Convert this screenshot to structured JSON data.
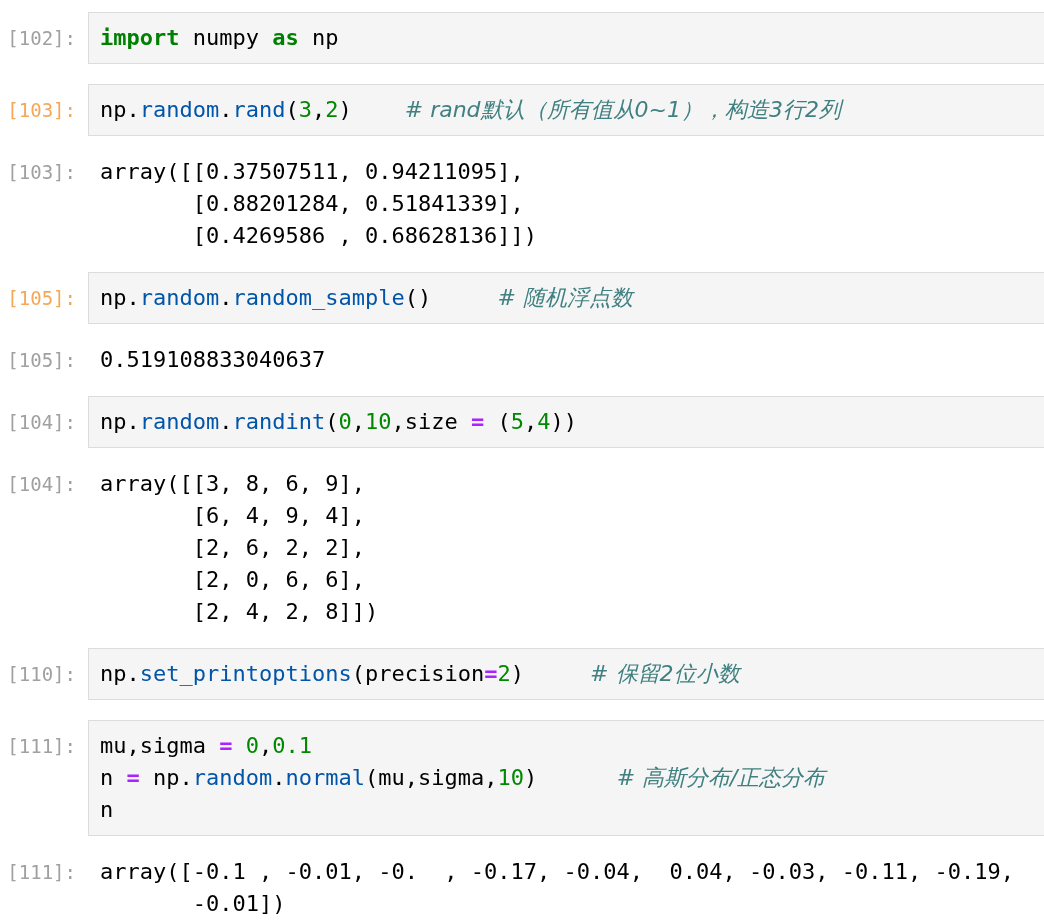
{
  "cells": [
    {
      "in_prompt": "[102]:",
      "highlighted": false,
      "input": [
        [
          {
            "text": "import",
            "kind": "keyword"
          },
          {
            "text": " numpy ",
            "kind": "plain"
          },
          {
            "text": "as",
            "kind": "keyword"
          },
          {
            "text": " np",
            "kind": "plain"
          }
        ]
      ]
    },
    {
      "in_prompt": "[103]:",
      "highlighted": true,
      "input": [
        [
          {
            "text": "np.",
            "kind": "plain"
          },
          {
            "text": "random",
            "kind": "attr"
          },
          {
            "text": ".",
            "kind": "plain"
          },
          {
            "text": "rand",
            "kind": "attr"
          },
          {
            "text": "(",
            "kind": "plain"
          },
          {
            "text": "3",
            "kind": "number"
          },
          {
            "text": ",",
            "kind": "plain"
          },
          {
            "text": "2",
            "kind": "number"
          },
          {
            "text": ")    ",
            "kind": "plain"
          },
          {
            "text": "# rand默认（所有值从0~1），构造3行2列",
            "kind": "comment"
          }
        ]
      ],
      "out_prompt": "[103]:",
      "output": [
        "array([[0.37507511, 0.94211095],",
        "       [0.88201284, 0.51841339],",
        "       [0.4269586 , 0.68628136]])"
      ]
    },
    {
      "in_prompt": "[105]:",
      "highlighted": true,
      "input": [
        [
          {
            "text": "np.",
            "kind": "plain"
          },
          {
            "text": "random",
            "kind": "attr"
          },
          {
            "text": ".",
            "kind": "plain"
          },
          {
            "text": "random_sample",
            "kind": "attr"
          },
          {
            "text": "()     ",
            "kind": "plain"
          },
          {
            "text": "# 随机浮点数",
            "kind": "comment"
          }
        ]
      ],
      "out_prompt": "[105]:",
      "output": [
        "0.519108833040637"
      ]
    },
    {
      "in_prompt": "[104]:",
      "highlighted": false,
      "input": [
        [
          {
            "text": "np.",
            "kind": "plain"
          },
          {
            "text": "random",
            "kind": "attr"
          },
          {
            "text": ".",
            "kind": "plain"
          },
          {
            "text": "randint",
            "kind": "attr"
          },
          {
            "text": "(",
            "kind": "plain"
          },
          {
            "text": "0",
            "kind": "number"
          },
          {
            "text": ",",
            "kind": "plain"
          },
          {
            "text": "10",
            "kind": "number"
          },
          {
            "text": ",size ",
            "kind": "plain"
          },
          {
            "text": "=",
            "kind": "operator"
          },
          {
            "text": " (",
            "kind": "plain"
          },
          {
            "text": "5",
            "kind": "number"
          },
          {
            "text": ",",
            "kind": "plain"
          },
          {
            "text": "4",
            "kind": "number"
          },
          {
            "text": "))",
            "kind": "plain"
          }
        ]
      ],
      "out_prompt": "[104]:",
      "output": [
        "array([[3, 8, 6, 9],",
        "       [6, 4, 9, 4],",
        "       [2, 6, 2, 2],",
        "       [2, 0, 6, 6],",
        "       [2, 4, 2, 8]])"
      ]
    },
    {
      "in_prompt": "[110]:",
      "highlighted": false,
      "input": [
        [
          {
            "text": "np.",
            "kind": "plain"
          },
          {
            "text": "set_printoptions",
            "kind": "attr"
          },
          {
            "text": "(precision",
            "kind": "plain"
          },
          {
            "text": "=",
            "kind": "operator"
          },
          {
            "text": "2",
            "kind": "number"
          },
          {
            "text": ")     ",
            "kind": "plain"
          },
          {
            "text": "# 保留2位小数",
            "kind": "comment"
          }
        ]
      ]
    },
    {
      "in_prompt": "[111]:",
      "highlighted": false,
      "input": [
        [
          {
            "text": "mu,sigma ",
            "kind": "plain"
          },
          {
            "text": "=",
            "kind": "operator"
          },
          {
            "text": " 0",
            "kind": "number"
          },
          {
            "text": ",",
            "kind": "plain"
          },
          {
            "text": "0.1",
            "kind": "number"
          }
        ],
        [
          {
            "text": "n ",
            "kind": "plain"
          },
          {
            "text": "=",
            "kind": "operator"
          },
          {
            "text": " np.",
            "kind": "plain"
          },
          {
            "text": "random",
            "kind": "attr"
          },
          {
            "text": ".",
            "kind": "plain"
          },
          {
            "text": "normal",
            "kind": "attr"
          },
          {
            "text": "(mu,sigma,",
            "kind": "plain"
          },
          {
            "text": "10",
            "kind": "number"
          },
          {
            "text": ")      ",
            "kind": "plain"
          },
          {
            "text": "# 高斯分布/正态分布",
            "kind": "comment"
          }
        ],
        [
          {
            "text": "n",
            "kind": "plain"
          }
        ]
      ],
      "out_prompt": "[111]:",
      "output": [
        "array([-0.1 , -0.01, -0.  , -0.17, -0.04,  0.04, -0.03, -0.11, -0.19,",
        "       -0.01])"
      ]
    }
  ]
}
